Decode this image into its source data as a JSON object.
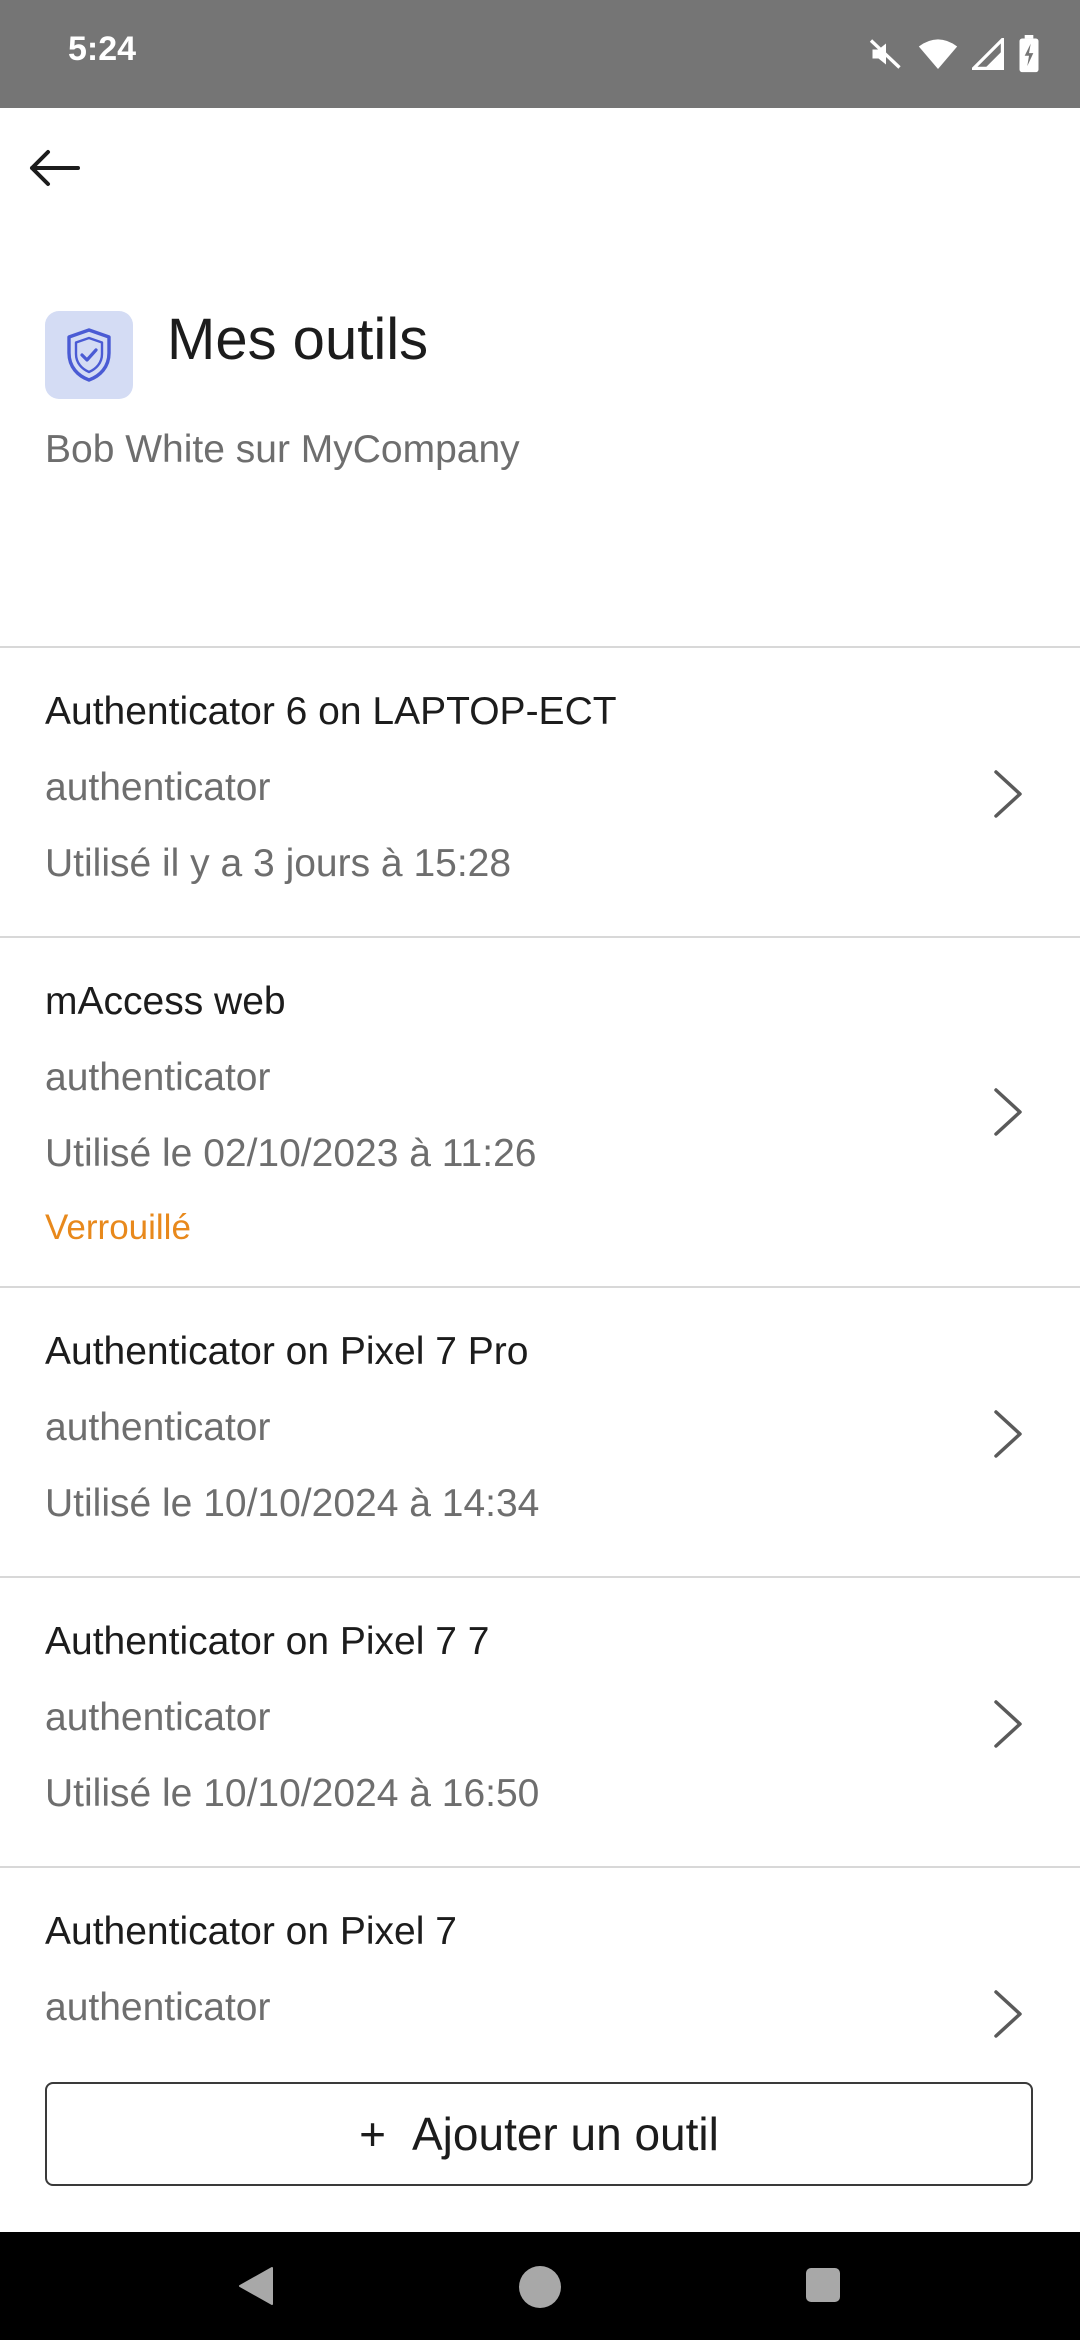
{
  "status_bar": {
    "time": "5:24",
    "icons": [
      "mute-icon",
      "wifi-icon",
      "signal-icon",
      "battery-charging-icon"
    ]
  },
  "header": {
    "title": "Mes outils",
    "subtitle": "Bob White sur MyCompany",
    "icon": "shield-check-icon",
    "icon_bg": "#d4dcf4",
    "icon_color": "#4a5bd4"
  },
  "tools": [
    {
      "title": "Authenticator 6 on LAPTOP-ECT",
      "type": "authenticator",
      "used": "Utilisé il y a 3 jours à 15:28",
      "status": ""
    },
    {
      "title": "mAccess web",
      "type": "authenticator",
      "used": "Utilisé le 02/10/2023 à 11:26",
      "status": "Verrouillé"
    },
    {
      "title": "Authenticator on Pixel 7 Pro",
      "type": "authenticator",
      "used": "Utilisé le 10/10/2024 à 14:34",
      "status": ""
    },
    {
      "title": "Authenticator on Pixel 7 7",
      "type": "authenticator",
      "used": "Utilisé le 10/10/2024 à 16:50",
      "status": ""
    },
    {
      "title": "Authenticator on Pixel 7",
      "type": "authenticator",
      "used": "",
      "status": ""
    }
  ],
  "add_button": {
    "label": "Ajouter un outil",
    "icon": "plus-icon"
  },
  "colors": {
    "status_bar": "#757575",
    "locked": "#e8891c",
    "muted_text": "#6e6e6e"
  }
}
